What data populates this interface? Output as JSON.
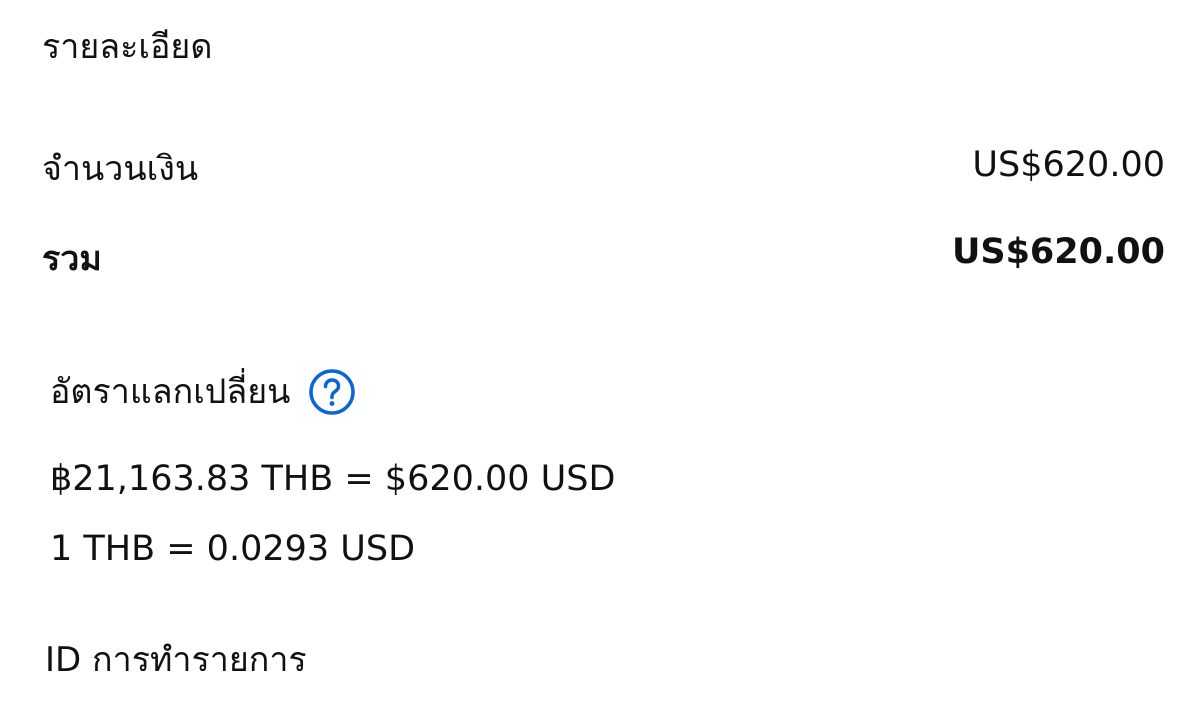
{
  "details": {
    "title": "รายละเอียด",
    "amount_label": "จำนวนเงิน",
    "amount_value": "US$620.00",
    "total_label": "รวม",
    "total_value": "US$620.00"
  },
  "exchange": {
    "heading": "อัตราแลกเปลี่ยน",
    "help_icon": "question-circle-icon",
    "accent_color": "#0a66d8",
    "conversion_line": "฿21,163.83 THB = $620.00 USD",
    "rate_line": "1 THB = 0.0293 USD"
  },
  "transaction": {
    "id_label": "ID การทำรายการ"
  }
}
